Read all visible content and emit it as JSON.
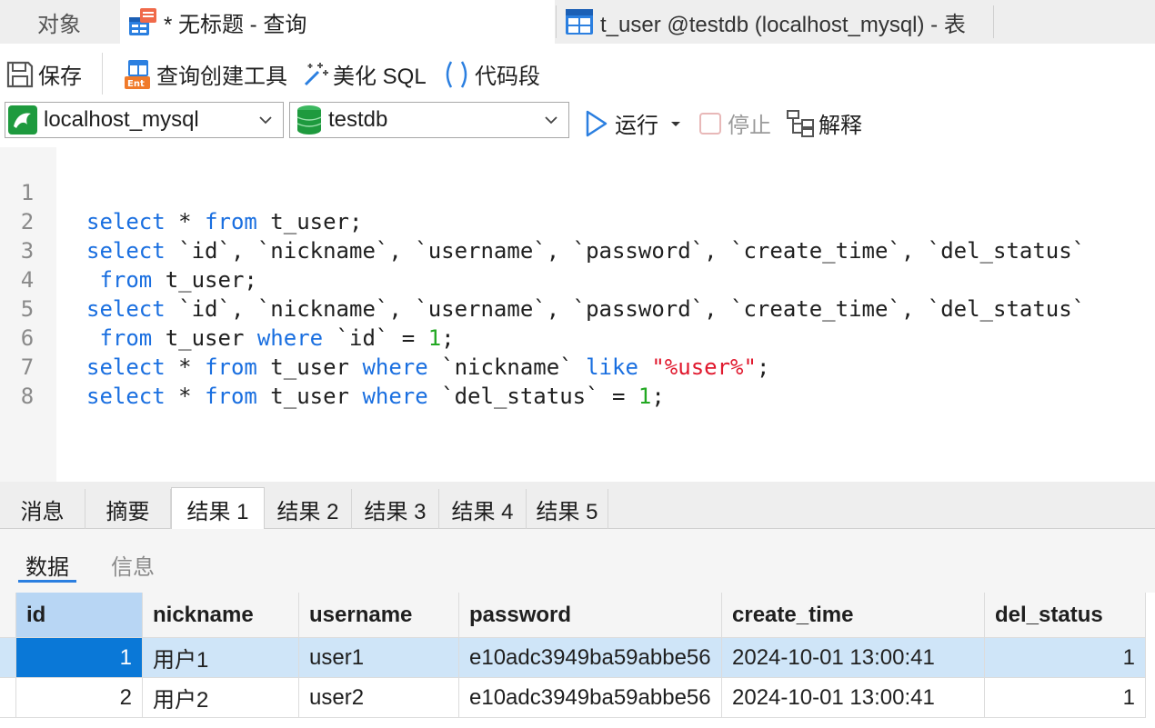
{
  "tabs": {
    "objects": "对象",
    "query": "* 无标题 - 查询",
    "table": "t_user @testdb (localhost_mysql) - 表"
  },
  "toolbar": {
    "save": "保存",
    "query_builder": "查询创建工具",
    "beautify": "美化 SQL",
    "snippet": "代码段",
    "connection": "localhost_mysql",
    "database": "testdb",
    "run": "运行",
    "stop": "停止",
    "explain": "解释"
  },
  "editor": {
    "line_numbers": [
      "1",
      "2",
      "3",
      "4",
      "5",
      "6",
      "7",
      "8"
    ]
  },
  "result_tabs": [
    "消息",
    "摘要",
    "结果 1",
    "结果 2",
    "结果 3",
    "结果 4",
    "结果 5"
  ],
  "active_result_tab": "结果 1",
  "sub_tabs": [
    "数据",
    "信息"
  ],
  "grid": {
    "columns": [
      "id",
      "nickname",
      "username",
      "password",
      "create_time",
      "del_status"
    ],
    "rows": [
      [
        "1",
        "用户1",
        "user1",
        "e10adc3949ba59abbe56",
        "2024-10-01 13:00:41",
        "1"
      ],
      [
        "2",
        "用户2",
        "user2",
        "e10adc3949ba59abbe56",
        "2024-10-01 13:00:41",
        "1"
      ]
    ]
  },
  "colors": {
    "keyword": "#1a6fe0",
    "number": "#22a822",
    "string": "#e0182d",
    "selection": "#0a78d7",
    "accent": "#2b7fe0"
  }
}
